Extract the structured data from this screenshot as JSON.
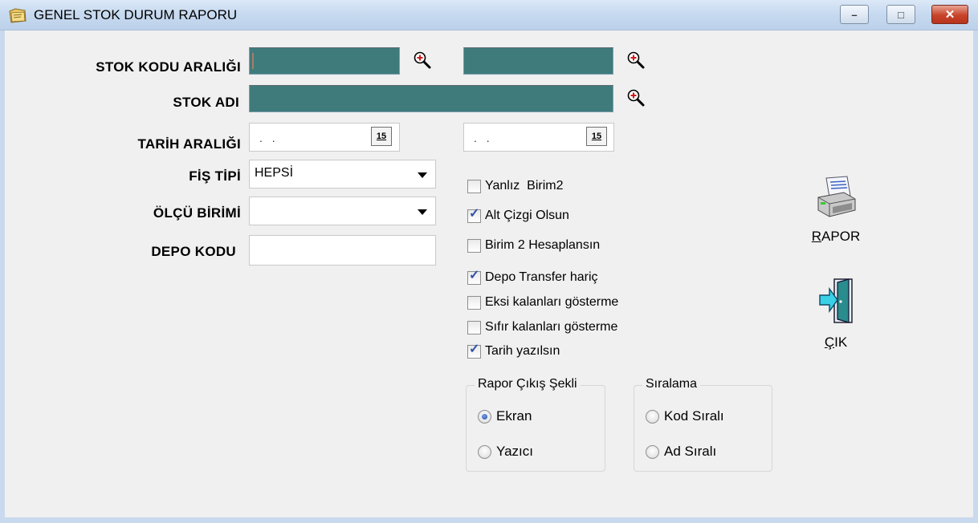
{
  "window": {
    "title": "GENEL STOK DURUM RAPORU",
    "icon": "folder-report-icon",
    "controls": {
      "minimize": "–",
      "maximize": "□",
      "close": "✕"
    }
  },
  "form": {
    "stok_kodu": {
      "label": "STOK KODU ARALIĞI",
      "from_value": "",
      "to_value": ""
    },
    "stok_adi": {
      "label": "STOK ADI",
      "value": ""
    },
    "tarih": {
      "label": "TARİH ARALIĞI",
      "from_value": ". .",
      "to_value": ". .",
      "cal_label": "15"
    },
    "fis_tipi": {
      "label": "FİŞ TİPİ",
      "value": "HEPSİ"
    },
    "olcu_birimi": {
      "label": "ÖLÇÜ BİRİMİ",
      "value": ""
    },
    "depo_kodu": {
      "label": "DEPO KODU",
      "value": ""
    }
  },
  "options": [
    {
      "label": "Yanlız  Birim2",
      "checked": false
    },
    {
      "label": "Alt Çizgi Olsun",
      "checked": true
    },
    {
      "label": "Birim 2 Hesaplansın",
      "checked": false
    },
    {
      "label": "Depo Transfer hariç",
      "checked": true
    },
    {
      "label": "Eksi kalanları gösterme",
      "checked": false
    },
    {
      "label": "Sıfır kalanları gösterme",
      "checked": false
    },
    {
      "label": "Tarih yazılsın",
      "checked": true
    }
  ],
  "output_group": {
    "legend": "Rapor Çıkış Şekli",
    "options": [
      {
        "label": "Ekran",
        "selected": true
      },
      {
        "label": "Yazıcı",
        "selected": false
      }
    ]
  },
  "sort_group": {
    "legend": "Sıralama",
    "options": [
      {
        "label": "Kod Sıralı",
        "selected": false
      },
      {
        "label": "Ad Sıralı",
        "selected": false
      }
    ]
  },
  "buttons": {
    "rapor": {
      "first": "R",
      "rest": "APOR",
      "icon": "printer-icon"
    },
    "cik": {
      "first": "Ç",
      "rest": "IK",
      "icon": "exit-door-icon"
    }
  },
  "colors": {
    "teal_field": "#3f7b7b",
    "check": "#3152a8",
    "titlebar": "#c6d9ef"
  }
}
